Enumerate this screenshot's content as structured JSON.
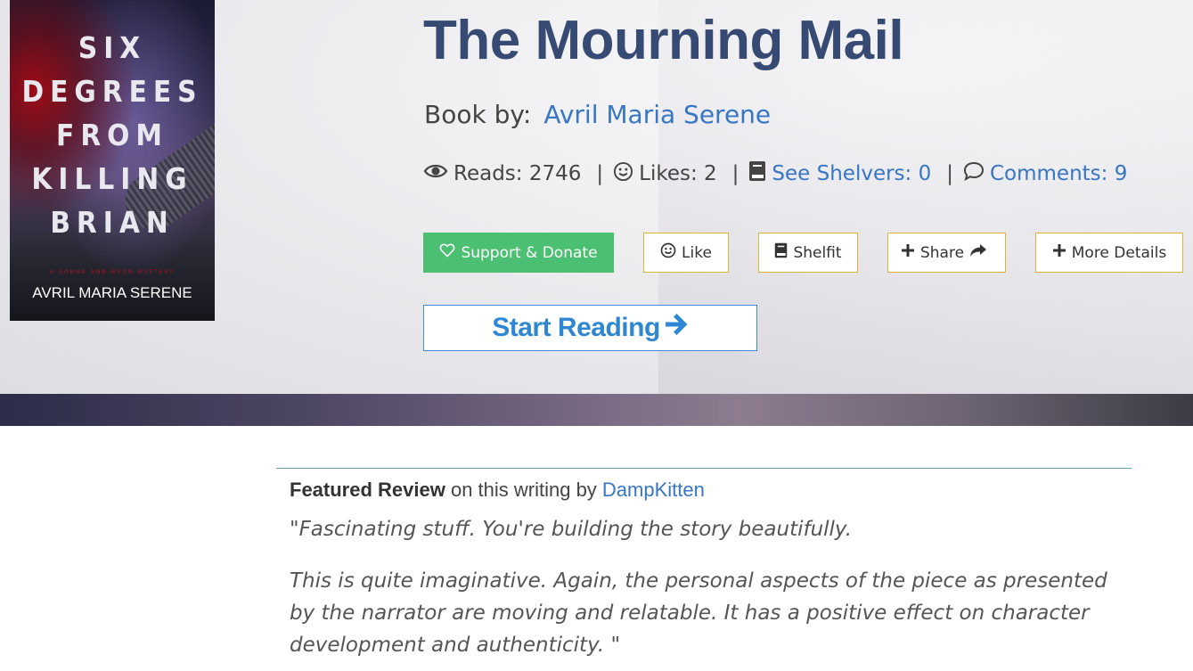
{
  "cover": {
    "title_lines": [
      "SIX",
      "DEGREES",
      "FROM",
      "KILLING",
      "BRIAN"
    ],
    "series_text": "A SONNA ANN MYON MYSTERY",
    "author": "AVRIL MARIA SERENE"
  },
  "book": {
    "title": "The Mourning Mail",
    "by_label": "Book by:",
    "author": "Avril Maria Serene"
  },
  "stats": {
    "reads": "Reads: 2746",
    "likes": "Likes: 2",
    "shelvers": "See Shelvers: 0",
    "comments": "Comments: 9",
    "separator": "|"
  },
  "actions": {
    "support": "Support & Donate",
    "like": "Like",
    "shelfit": "Shelfit",
    "share": "Share",
    "more": "More Details",
    "start_reading": "Start Reading"
  },
  "review": {
    "label": "Featured Review",
    "middle": " on this writing by ",
    "reviewer": "DampKitten",
    "paragraph1": "\"Fascinating stuff. You're building the story beautifully.",
    "paragraph2": "This is quite imaginative. Again, the personal aspects of the piece as presented by the narrator are moving and relatable. It has a positive effect on character development and authenticity. \""
  },
  "colors": {
    "title": "#364a73",
    "link": "#3676c4",
    "support_bg": "#4cc072",
    "button_border": "#e1b437",
    "start_border": "#3a8fd8"
  },
  "icons": {
    "reads": "eye-icon",
    "likes": "smile-icon",
    "shelvers": "book-icon",
    "comments": "comment-icon",
    "support": "heart-icon",
    "share": "share-arrow-icon",
    "more": "plus-icon",
    "start": "arrow-right-icon"
  }
}
